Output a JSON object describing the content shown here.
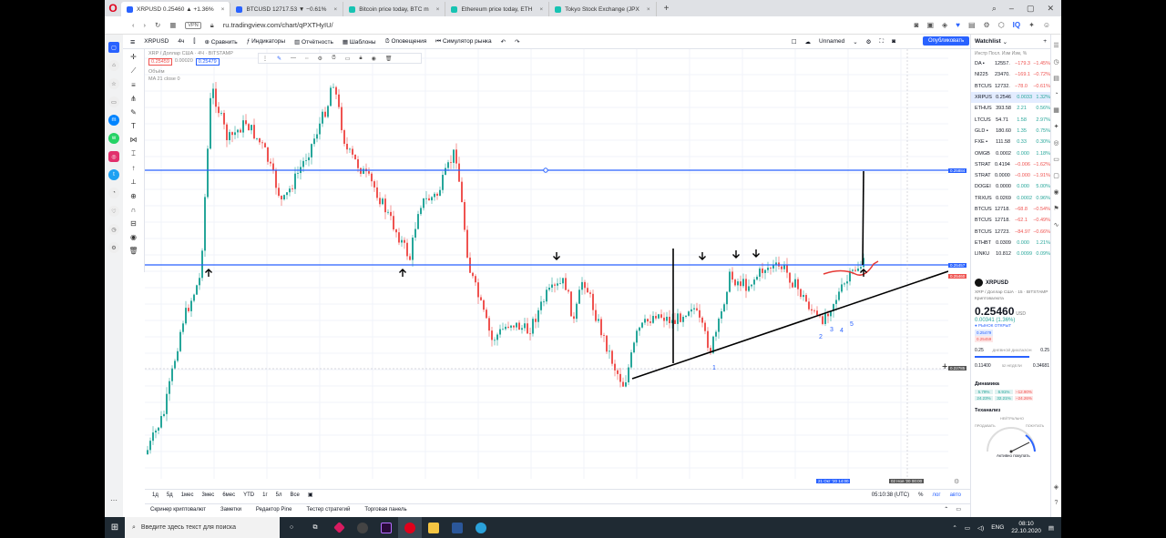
{
  "browser": {
    "tabs": [
      {
        "label": "XRPUSD 0.25460 ▲ +1.36%",
        "color": "#2962ff",
        "active": true
      },
      {
        "label": "BTCUSD 12717.53 ▼ −0.61%",
        "color": "#2962ff",
        "active": false
      },
      {
        "label": "Bitcoin price today, BTC m",
        "color": "#17c3b2",
        "active": false
      },
      {
        "label": "Ethereum price today, ETH",
        "color": "#17c3b2",
        "active": false
      },
      {
        "label": "Tokyo Stock Exchange (JPX",
        "color": "#17c3b2",
        "active": false
      }
    ],
    "new_tab": "+",
    "url": "ru.tradingview.com/chart/qPXTHyIU/",
    "vpn": "VPN"
  },
  "toolbar": {
    "symbol": "XRPUSD",
    "interval": "4ч",
    "compare": "Сравнить",
    "indicators": "Индикаторы",
    "financials": "Отчётность",
    "templates": "Шаблоны",
    "alerts": "Оповещения",
    "replay": "Симулятор рынка",
    "layout_name": "Unnamed",
    "publish": "Опубликовать"
  },
  "legend": {
    "title": "XRP / Доллар США · 4Ч · BITSTAMP",
    "bid": "0.25459",
    "spread": "0.00020",
    "ask": "0.25479",
    "volume": "Объём",
    "ma": "MA 21 close 0"
  },
  "chart_data": {
    "type": "candlestick",
    "symbol": "XRPUSD",
    "horizontal_levels": [
      0.2588,
      0.2545
    ],
    "last_price": 0.2546,
    "annotations": [
      "1",
      "2",
      "3",
      "4",
      "5"
    ],
    "price_labels": [
      "0.25884",
      "0.25457",
      "0.25460",
      "0.22785"
    ],
    "time_labels": [
      "21 Окт '20",
      "14:00",
      "02 Ноя '20",
      "00:00"
    ]
  },
  "timeframes": [
    "1д",
    "5д",
    "1мес",
    "3мес",
    "6мес",
    "YTD",
    "1г",
    "5л",
    "Все"
  ],
  "clock": "05:10:38 (UTC)",
  "scale": {
    "pct": "%",
    "log": "лог",
    "auto": "авто"
  },
  "bottom_tabs": [
    "Скринер криптовалют",
    "Заметки",
    "Редактор Pine",
    "Тестер стратегий",
    "Торговая панель"
  ],
  "watchlist": {
    "title": "Watchlist",
    "columns": "Инстр Посл. Изм Изм, %",
    "rows": [
      {
        "sym": "DA ▪",
        "last": "12557.",
        "chg": "−179.3",
        "pct": "−1.45%",
        "dir": "neg"
      },
      {
        "sym": "NI225",
        "last": "23470.",
        "chg": "−169.1",
        "pct": "−0.72%",
        "dir": "neg"
      },
      {
        "sym": "BTCUS",
        "last": "12732.",
        "chg": "−78.0",
        "pct": "−0.61%",
        "dir": "neg"
      },
      {
        "sym": "XRPUS",
        "last": "0.2546",
        "chg": "0.0033",
        "pct": "1.32%",
        "dir": "pos"
      },
      {
        "sym": "ETHUS",
        "last": "393.58",
        "chg": "2.21",
        "pct": "0.56%",
        "dir": "pos"
      },
      {
        "sym": "LTCUS",
        "last": "54.71",
        "chg": "1.58",
        "pct": "2.97%",
        "dir": "pos"
      },
      {
        "sym": "GLD ▪",
        "last": "180.60",
        "chg": "1.35",
        "pct": "0.75%",
        "dir": "pos"
      },
      {
        "sym": "FXE ▪",
        "last": "111.58",
        "chg": "0.33",
        "pct": "0.30%",
        "dir": "pos"
      },
      {
        "sym": "OMGB",
        "last": "0.0002",
        "chg": "0.000",
        "pct": "1.18%",
        "dir": "pos"
      },
      {
        "sym": "STRAT",
        "last": "0.4194",
        "chg": "−0.006",
        "pct": "−1.62%",
        "dir": "neg"
      },
      {
        "sym": "STRAT",
        "last": "0.0000",
        "chg": "−0.000",
        "pct": "−1.91%",
        "dir": "neg"
      },
      {
        "sym": "DOGEI",
        "last": "0.0000",
        "chg": "0.000",
        "pct": "5.00%",
        "dir": "pos"
      },
      {
        "sym": "TRXUS",
        "last": "0.0269",
        "chg": "0.0002",
        "pct": "0.96%",
        "dir": "pos"
      },
      {
        "sym": "BTCUS",
        "last": "12718.",
        "chg": "−68.8",
        "pct": "−0.54%",
        "dir": "neg"
      },
      {
        "sym": "BTCUS",
        "last": "12718.",
        "chg": "−62.1",
        "pct": "−0.49%",
        "dir": "neg"
      },
      {
        "sym": "BTCUS",
        "last": "12723.",
        "chg": "−84.97",
        "pct": "−0.66%",
        "dir": "neg"
      },
      {
        "sym": "ETHBT",
        "last": "0.0309",
        "chg": "0.000",
        "pct": "1.21%",
        "dir": "pos"
      },
      {
        "sym": "LINKU",
        "last": "10.812",
        "chg": "0.0099",
        "pct": "0.09%",
        "dir": "pos"
      }
    ]
  },
  "details": {
    "symbol": "XRPUSD",
    "name": "XRP / Доллар США · 15 · BITSTAMP",
    "category": "Криптовалюта",
    "price": "0.25460",
    "currency": "USD",
    "change": "0.00341 (1.36%)",
    "market": "● РЫНОК ОТКРЫТ",
    "day_low": "0.25",
    "day_high": "0.25",
    "range_label": "ДНЕВНОЙ ДИАПАЗОН",
    "week_low": "0.11400",
    "week_high": "0.34681",
    "week_label": "52 НЕДЕЛИ",
    "dynamics": "Динамика",
    "dyn_values": [
      "5.79%",
      "6.91%",
      "−12.90%",
      "24.23%",
      "32.21%",
      "−24.26%"
    ],
    "technicals": "Теханализ",
    "neutral": "НЕЙТРАЛЬНО",
    "sell": "ПРОДАВАТЬ",
    "buy": "ПОКУПАТЬ",
    "strong_buy": "Активно покупать"
  },
  "taskbar": {
    "search_placeholder": "Введите здесь текст для поиска",
    "lang": "ENG",
    "time": "08:10",
    "date": "22.10.2020"
  }
}
